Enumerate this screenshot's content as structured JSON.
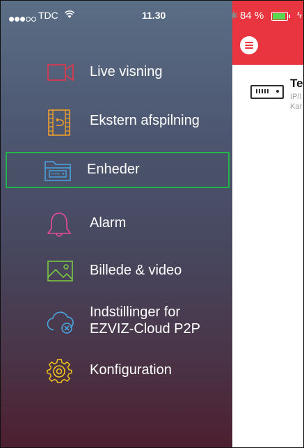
{
  "status_bar": {
    "carrier": "TDC",
    "time": "11.30",
    "battery": "84 %",
    "battery_level": 0.84,
    "colors": {
      "battery_fill": "#5ad84d"
    }
  },
  "header": {
    "menu_icon": "hamburger-icon",
    "color": "#e8353f"
  },
  "device": {
    "name": "Te",
    "type_line": "IP/I",
    "extra_line": "Kar",
    "icon": "nvr-icon"
  },
  "sidebar": {
    "items": [
      {
        "label": "Live visning",
        "icon": "video-camera-icon",
        "color": "#e8354a"
      },
      {
        "label": "Ekstern afspilning",
        "icon": "film-playback-icon",
        "color": "#f0a02a"
      },
      {
        "label": "Enheder",
        "icon": "devices-folder-icon",
        "color": "#4aa3df",
        "selected": true
      },
      {
        "label": "Alarm",
        "icon": "bell-icon",
        "color": "#e84a9a"
      },
      {
        "label": "Billede & video",
        "icon": "image-icon",
        "color": "#7ac943"
      },
      {
        "label": "Indstillinger for\nEZVIZ-Cloud P2P",
        "icon": "cloud-settings-icon",
        "color": "#4aa3df"
      },
      {
        "label": "Konfiguration",
        "icon": "gear-icon",
        "color": "#f0c419"
      }
    ],
    "selected_highlight": "#24b34a"
  }
}
